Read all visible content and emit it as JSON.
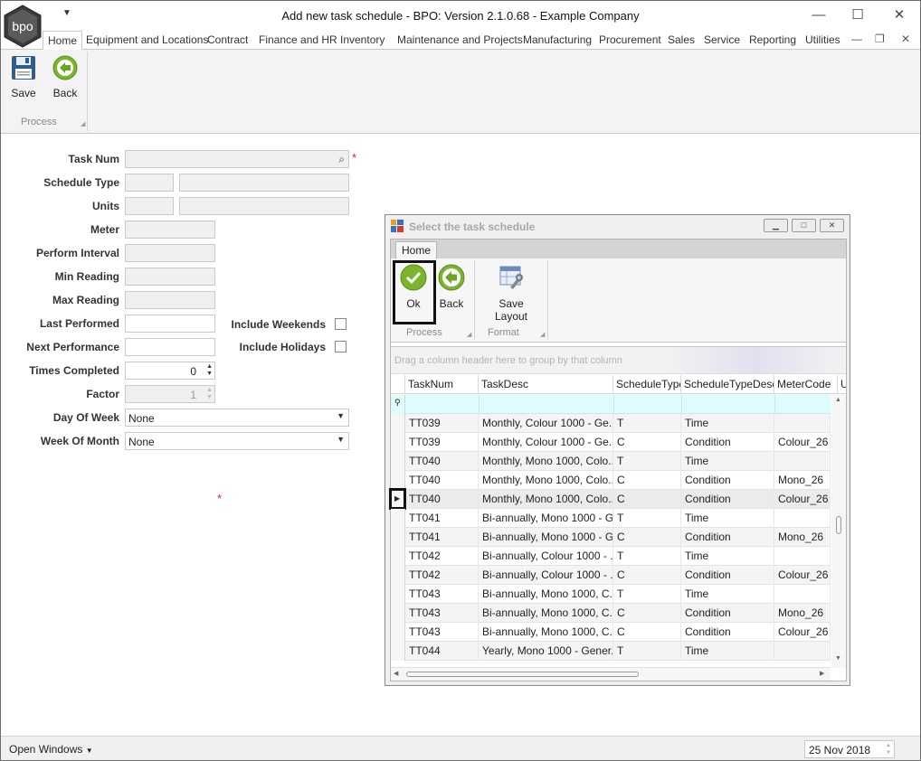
{
  "window": {
    "title": "Add new task schedule - BPO: Version 2.1.0.68 - Example Company",
    "logo_text": "bpo",
    "minimize": "—",
    "maximize": "☐",
    "close": "✕"
  },
  "menu": {
    "tabs": [
      "Home",
      "Equipment and Locations",
      "Contract",
      "Finance and HR",
      "Inventory",
      "Maintenance and Projects",
      "Manufacturing",
      "Procurement",
      "Sales",
      "Service",
      "Reporting",
      "Utilities"
    ],
    "active_tab": "Home"
  },
  "ribbon": {
    "save_label": "Save",
    "back_label": "Back",
    "group_label": "Process"
  },
  "form": {
    "labels": {
      "task_num": "Task Num",
      "schedule_type": "Schedule Type",
      "units": "Units",
      "meter": "Meter",
      "perform_interval": "Perform Interval",
      "min_reading": "Min Reading",
      "max_reading": "Max Reading",
      "last_performed": "Last Performed",
      "next_performance": "Next Performance",
      "times_completed": "Times Completed",
      "factor": "Factor",
      "day_of_week": "Day Of Week",
      "week_of_month": "Week Of Month",
      "include_weekends": "Include Weekends",
      "include_holidays": "Include Holidays"
    },
    "values": {
      "times_completed": "0",
      "factor": "1",
      "day_of_week": "None",
      "week_of_month": "None"
    },
    "required_marker": "*"
  },
  "statusbar": {
    "open_windows": "Open Windows",
    "date": "25 Nov 2018"
  },
  "dialog": {
    "title": "Select the task schedule",
    "tab": "Home",
    "ok_label": "Ok",
    "back_label": "Back",
    "save_layout_label": "Save Layout",
    "process_group": "Process",
    "format_group": "Format",
    "group_panel_hint": "Drag a column header here to group by that column",
    "columns": [
      "TaskNum",
      "TaskDesc",
      "ScheduleType",
      "ScheduleTypeDesc",
      "MeterCode",
      "U"
    ],
    "rows": [
      [
        "TT039",
        "Monthly, Colour 1000 - Ge...",
        "T",
        "Time",
        ""
      ],
      [
        "TT039",
        "Monthly, Colour 1000 - Ge...",
        "C",
        "Condition",
        "Colour_26"
      ],
      [
        "TT040",
        "Monthly, Mono 1000, Colo...",
        "T",
        "Time",
        ""
      ],
      [
        "TT040",
        "Monthly, Mono 1000, Colo...",
        "C",
        "Condition",
        "Mono_26"
      ],
      [
        "TT040",
        "Monthly, Mono 1000, Colo...",
        "C",
        "Condition",
        "Colour_26"
      ],
      [
        "TT041",
        "Bi-annually, Mono 1000 - G...",
        "T",
        "Time",
        ""
      ],
      [
        "TT041",
        "Bi-annually, Mono 1000 - G...",
        "C",
        "Condition",
        "Mono_26"
      ],
      [
        "TT042",
        "Bi-annually, Colour 1000 - ...",
        "T",
        "Time",
        ""
      ],
      [
        "TT042",
        "Bi-annually, Colour 1000 - ...",
        "C",
        "Condition",
        "Colour_26"
      ],
      [
        "TT043",
        "Bi-annually, Mono 1000, C...",
        "T",
        "Time",
        ""
      ],
      [
        "TT043",
        "Bi-annually, Mono 1000, C...",
        "C",
        "Condition",
        "Mono_26"
      ],
      [
        "TT043",
        "Bi-annually, Mono 1000, C...",
        "C",
        "Condition",
        "Colour_26"
      ],
      [
        "TT044",
        "Yearly, Mono 1000 - Gener...",
        "T",
        "Time",
        ""
      ]
    ],
    "focused_row": 4
  }
}
